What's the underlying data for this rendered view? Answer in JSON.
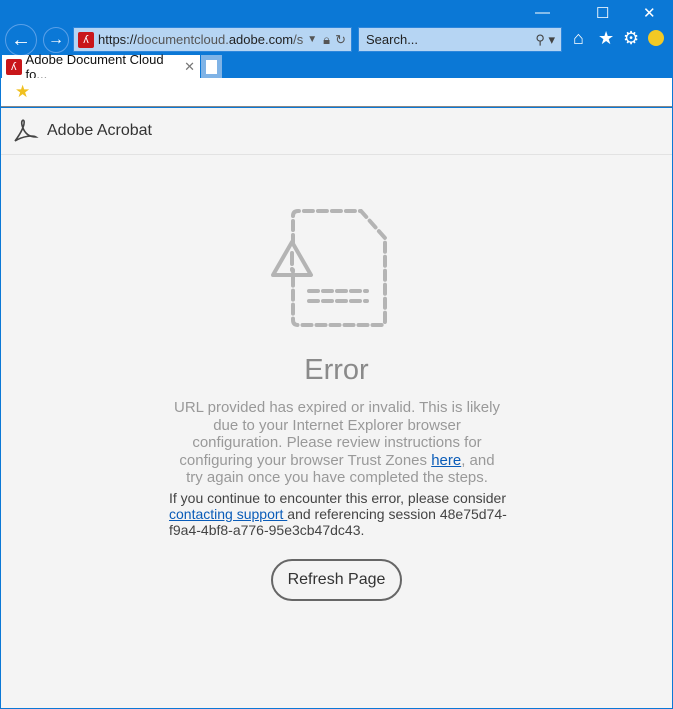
{
  "browser": {
    "url_scheme": "https://",
    "url_host_pre": "documentcloud.",
    "url_host": "adobe.com",
    "url_rest": "/s",
    "search_placeholder": "Search...",
    "tab_title": "Adobe Document Cloud fo..."
  },
  "page": {
    "app_name": "Adobe Acrobat",
    "error_title": "Error",
    "message_pre": "URL provided has expired or invalid. This is likely due to your Internet Explorer browser configuration. Please review instructions for configuring your browser Trust Zones ",
    "here_link": "here",
    "message_post": ", and try again once you have completed the steps.",
    "support_pre": "If you continue to encounter this error, please consider ",
    "support_link": "contacting support ",
    "support_post": "and referencing session 48e75d74-f9a4-4bf8-a776-95e3cb47dc43.",
    "refresh_label": "Refresh Page"
  }
}
